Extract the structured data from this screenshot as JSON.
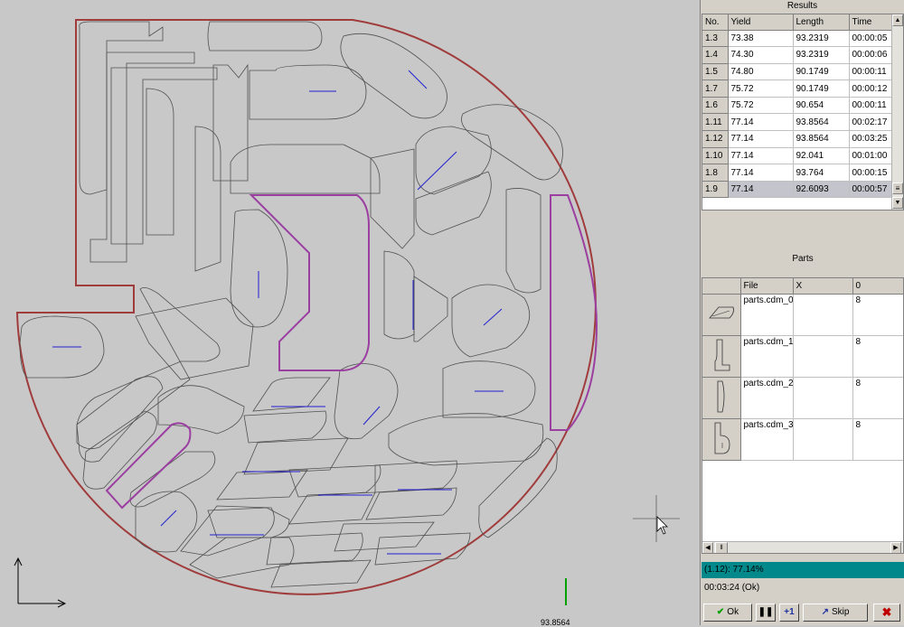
{
  "results": {
    "title": "Results",
    "columns": [
      "No.",
      "Yield",
      "Length",
      "Time"
    ],
    "rows": [
      {
        "no": "1.3",
        "yield": "73.38",
        "length": "93.2319",
        "time": "00:00:05"
      },
      {
        "no": "1.4",
        "yield": "74.30",
        "length": "93.2319",
        "time": "00:00:06"
      },
      {
        "no": "1.5",
        "yield": "74.80",
        "length": "90.1749",
        "time": "00:00:11"
      },
      {
        "no": "1.7",
        "yield": "75.72",
        "length": "90.1749",
        "time": "00:00:12"
      },
      {
        "no": "1.6",
        "yield": "75.72",
        "length": "90.654",
        "time": "00:00:11"
      },
      {
        "no": "1.11",
        "yield": "77.14",
        "length": "93.8564",
        "time": "00:02:17"
      },
      {
        "no": "1.12",
        "yield": "77.14",
        "length": "93.8564",
        "time": "00:03:25"
      },
      {
        "no": "1.10",
        "yield": "77.14",
        "length": "92.041",
        "time": "00:01:00"
      },
      {
        "no": "1.8",
        "yield": "77.14",
        "length": "93.764",
        "time": "00:00:15"
      },
      {
        "no": "1.9",
        "yield": "77.14",
        "length": "92.6093",
        "time": "00:00:57"
      }
    ]
  },
  "parts": {
    "title": "Parts",
    "columns": [
      "",
      "File",
      "X",
      "0"
    ],
    "rows": [
      {
        "icon": "parallelogram-part-icon",
        "file": "parts.cdm_0",
        "x": "",
        "qty": "8"
      },
      {
        "icon": "l-bracket-part-icon",
        "file": "parts.cdm_1",
        "x": "",
        "qty": "8"
      },
      {
        "icon": "slot-part-icon",
        "file": "parts.cdm_2",
        "x": "",
        "qty": "8"
      },
      {
        "icon": "b-shape-part-icon",
        "file": "parts.cdm_3",
        "x": "",
        "qty": "8"
      }
    ]
  },
  "progress_text": "(1.12): 77.14%",
  "status_text": "00:03:24 (Ok)",
  "canvas_readout": "93.8564",
  "toolbar": {
    "ok_label": "Ok",
    "plus_label": "+1",
    "skip_label": "Skip"
  },
  "colors": {
    "sheet_outline": "#a03c3c",
    "selected_part": "#9b3fa0",
    "cut_line": "#2020d0",
    "progress": "#00888a"
  }
}
